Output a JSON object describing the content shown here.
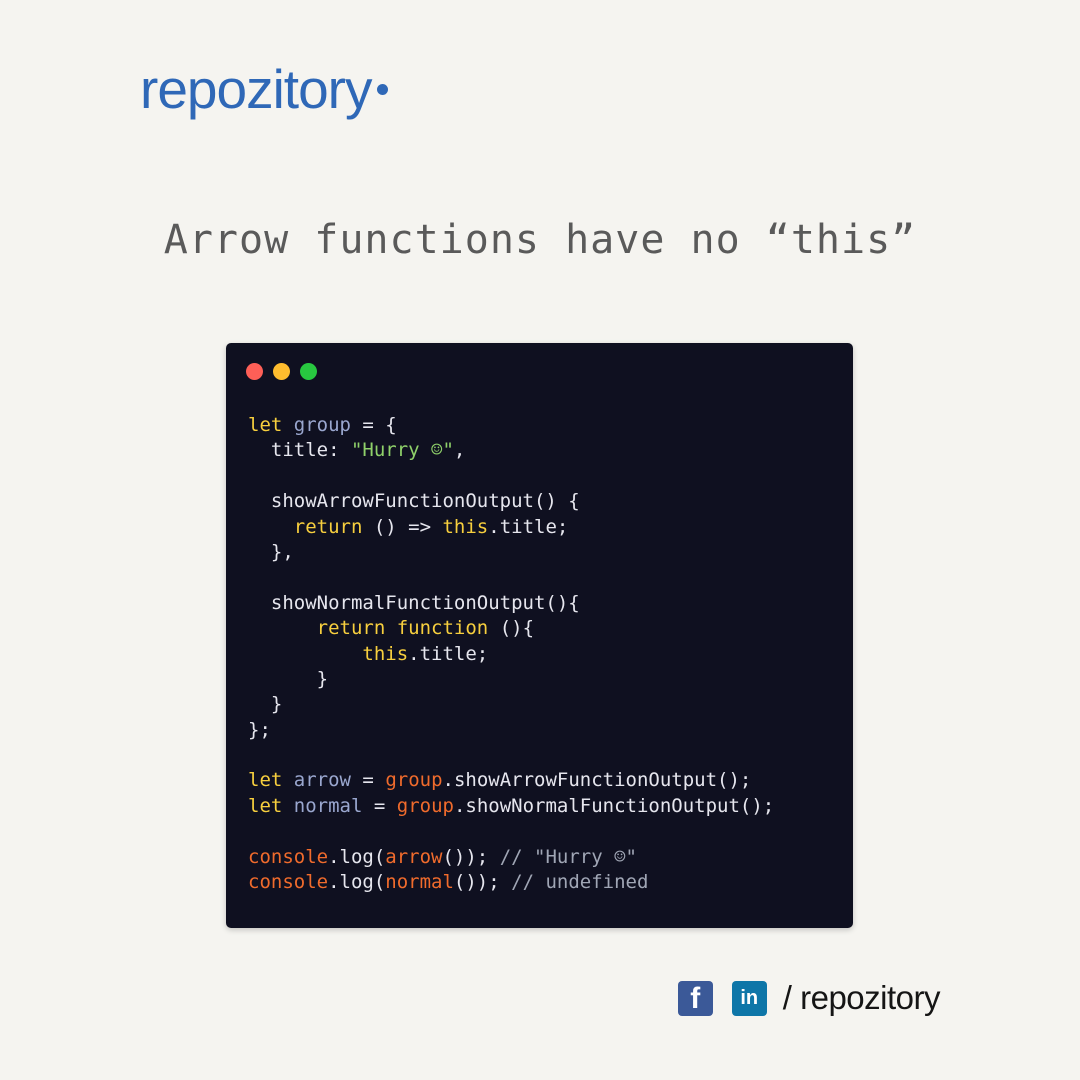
{
  "brand": {
    "name": "repozitory",
    "color": "#2f68b7"
  },
  "headline": "Arrow functions have no “this”",
  "code_window": {
    "dots": [
      "red",
      "yellow",
      "green"
    ],
    "lines": [
      [
        {
          "t": "let",
          "c": "kw"
        },
        {
          "t": " "
        },
        {
          "t": "group",
          "c": "var"
        },
        {
          "t": " = {"
        }
      ],
      [
        {
          "t": "  title: "
        },
        {
          "t": "\"Hurry ☺\"",
          "c": "str"
        },
        {
          "t": ","
        }
      ],
      [],
      [
        {
          "t": "  showArrowFunctionOutput() {"
        }
      ],
      [
        {
          "t": "    "
        },
        {
          "t": "return",
          "c": "kw"
        },
        {
          "t": " () => "
        },
        {
          "t": "this",
          "c": "kw"
        },
        {
          "t": ".title;"
        }
      ],
      [
        {
          "t": "  },"
        }
      ],
      [],
      [
        {
          "t": "  showNormalFunctionOutput(){"
        }
      ],
      [
        {
          "t": "      "
        },
        {
          "t": "return",
          "c": "kw"
        },
        {
          "t": " "
        },
        {
          "t": "function",
          "c": "kw"
        },
        {
          "t": " (){"
        }
      ],
      [
        {
          "t": "          "
        },
        {
          "t": "this",
          "c": "kw"
        },
        {
          "t": ".title;"
        }
      ],
      [
        {
          "t": "      }"
        }
      ],
      [
        {
          "t": "  }"
        }
      ],
      [
        {
          "t": "};"
        }
      ],
      [],
      [
        {
          "t": "let",
          "c": "kw"
        },
        {
          "t": " "
        },
        {
          "t": "arrow",
          "c": "var"
        },
        {
          "t": " = "
        },
        {
          "t": "group",
          "c": "obj"
        },
        {
          "t": ".showArrowFunctionOutput();"
        }
      ],
      [
        {
          "t": "let",
          "c": "kw"
        },
        {
          "t": " "
        },
        {
          "t": "normal",
          "c": "var"
        },
        {
          "t": " = "
        },
        {
          "t": "group",
          "c": "obj"
        },
        {
          "t": ".showNormalFunctionOutput();"
        }
      ],
      [],
      [
        {
          "t": "console",
          "c": "obj"
        },
        {
          "t": ".log("
        },
        {
          "t": "arrow",
          "c": "obj"
        },
        {
          "t": "()); "
        },
        {
          "t": "// \"Hurry ☺\"",
          "c": "cm"
        }
      ],
      [
        {
          "t": "console",
          "c": "obj"
        },
        {
          "t": ".log("
        },
        {
          "t": "normal",
          "c": "obj"
        },
        {
          "t": "()); "
        },
        {
          "t": "// undefined",
          "c": "cm"
        }
      ]
    ]
  },
  "footer": {
    "icons": [
      "facebook-icon",
      "linkedin-icon"
    ],
    "facebook_glyph": "f",
    "linkedin_glyph": "in",
    "handle": "/ repozitory"
  }
}
